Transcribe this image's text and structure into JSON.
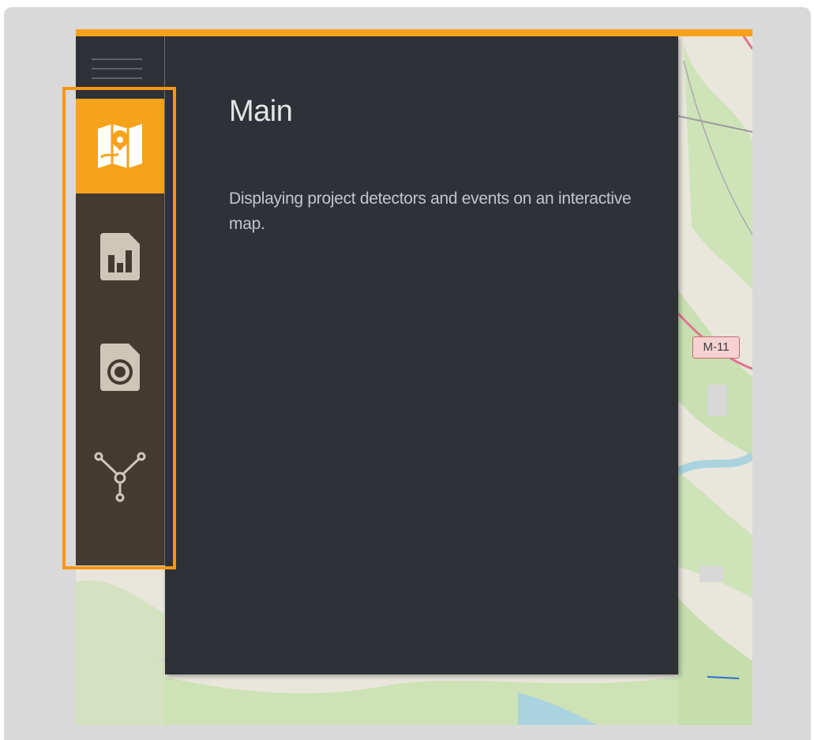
{
  "panel": {
    "title": "Main",
    "description": "Displaying project detectors and events on an interactive map."
  },
  "sidebar": {
    "items": [
      {
        "name": "map",
        "icon": "map-marker-icon",
        "active": true
      },
      {
        "name": "statistics",
        "icon": "chart-card-icon",
        "active": false
      },
      {
        "name": "detectors",
        "icon": "detector-card-icon",
        "active": false
      },
      {
        "name": "network",
        "icon": "network-nodes-icon",
        "active": false
      }
    ]
  },
  "map": {
    "road_label": "M-11"
  },
  "colors": {
    "accent": "#f7a21b",
    "highlight": "#fa9614",
    "panel_bg": "#2e3136",
    "sidebar_bg": "#443a2f",
    "frame_bg": "#d9d9d9"
  }
}
